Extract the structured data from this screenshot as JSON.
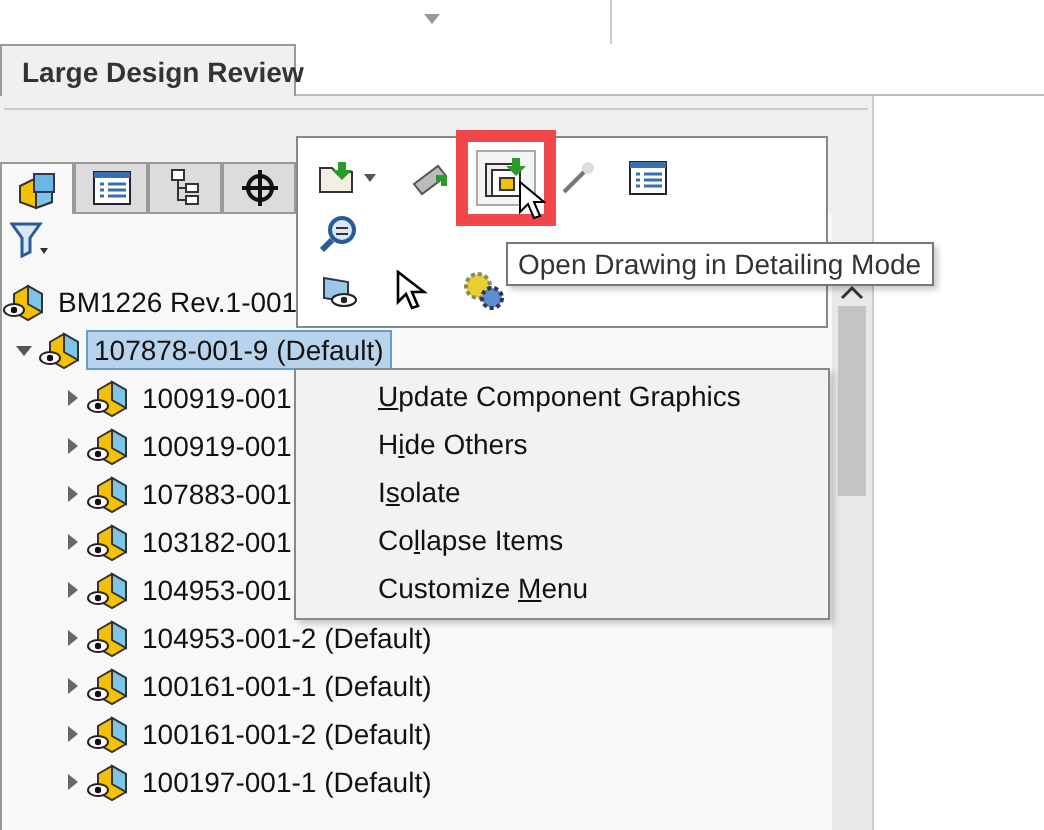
{
  "tab": {
    "label": "Large Design Review"
  },
  "panel_tabs": [
    {
      "kind": "assembly",
      "selected": true
    },
    {
      "kind": "list",
      "selected": false
    },
    {
      "kind": "tree",
      "selected": false
    },
    {
      "kind": "target",
      "selected": false
    }
  ],
  "tree": [
    {
      "label": "BM1226 Rev.1-001",
      "selected": false,
      "children": [
        {
          "label": "107878-001-9 (Default)",
          "expanded": true,
          "selected": true,
          "children": [
            {
              "label": "100919-001",
              "expanded": false,
              "selected": false
            },
            {
              "label": "100919-001",
              "expanded": false,
              "selected": false
            },
            {
              "label": "107883-001",
              "expanded": false,
              "selected": false
            },
            {
              "label": "103182-001",
              "expanded": false,
              "selected": false
            },
            {
              "label": "104953-001",
              "expanded": false,
              "selected": false
            },
            {
              "label": "104953-001-2 (Default)",
              "expanded": false,
              "selected": false
            },
            {
              "label": "100161-001-1 (Default)",
              "expanded": false,
              "selected": false
            },
            {
              "label": "100161-001-2 (Default)",
              "expanded": false,
              "selected": false
            },
            {
              "label": "100197-001-1 (Default)",
              "expanded": false,
              "selected": false
            }
          ]
        }
      ]
    }
  ],
  "toolbar_popup": {
    "rows": [
      [
        {
          "kind": "open-folder",
          "dropdown": true,
          "highlighted": false
        },
        {
          "kind": "tube",
          "dropdown": false,
          "highlighted": false
        },
        {
          "kind": "drawing",
          "dropdown": false,
          "highlighted": true
        },
        {
          "kind": "wand",
          "dropdown": false,
          "highlighted": false
        },
        {
          "kind": "list",
          "dropdown": false,
          "highlighted": false
        }
      ],
      [
        {
          "kind": "zoom",
          "dropdown": false,
          "highlighted": false
        }
      ],
      [
        {
          "kind": "eye-part",
          "dropdown": false,
          "highlighted": false
        },
        {
          "kind": "pointer",
          "dropdown": false,
          "highlighted": false
        },
        {
          "kind": "gears",
          "dropdown": false,
          "highlighted": false
        }
      ]
    ],
    "tooltip": "Open Drawing in Detailing Mode"
  },
  "context_menu": [
    {
      "key": "U",
      "after": "pdate Component Graphics"
    },
    {
      "before": "H",
      "key": "i",
      "after": "de Others"
    },
    {
      "before": "I",
      "key": "s",
      "after": "olate"
    },
    {
      "before": "Co",
      "key": "l",
      "after": "lapse Items"
    },
    {
      "before": "Customize ",
      "key": "M",
      "after": "enu"
    }
  ]
}
